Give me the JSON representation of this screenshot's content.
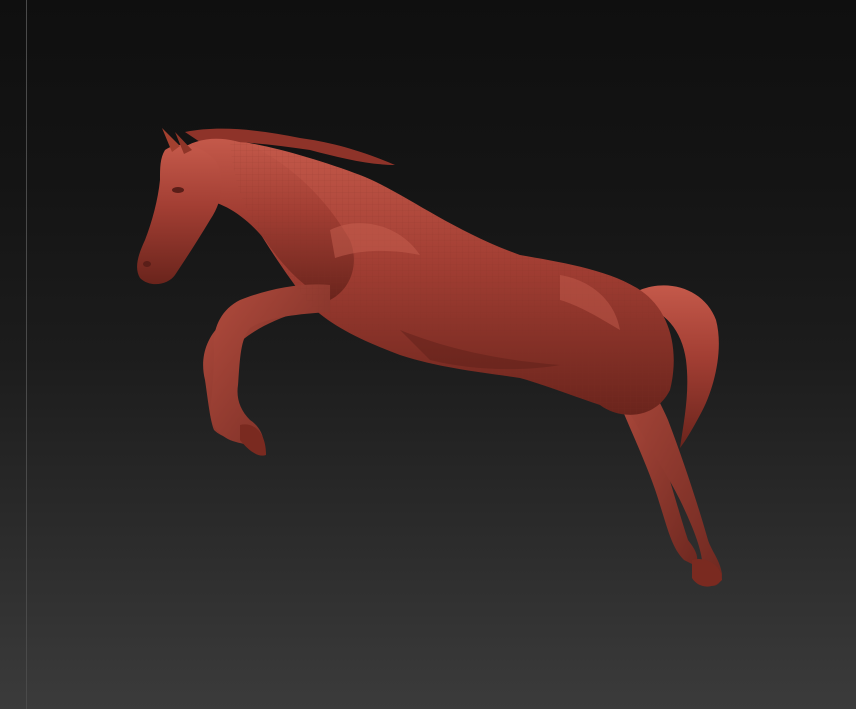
{
  "viewport": {
    "background_top": "#0f0f0f",
    "background_bottom": "#3b3b3b",
    "edge_line_color": "#4a4a4a"
  },
  "model": {
    "subject": "horse-sculpt",
    "material_color": "#9a3a30",
    "highlight_color": "#c4594a",
    "shadow_color": "#5a1e18"
  }
}
